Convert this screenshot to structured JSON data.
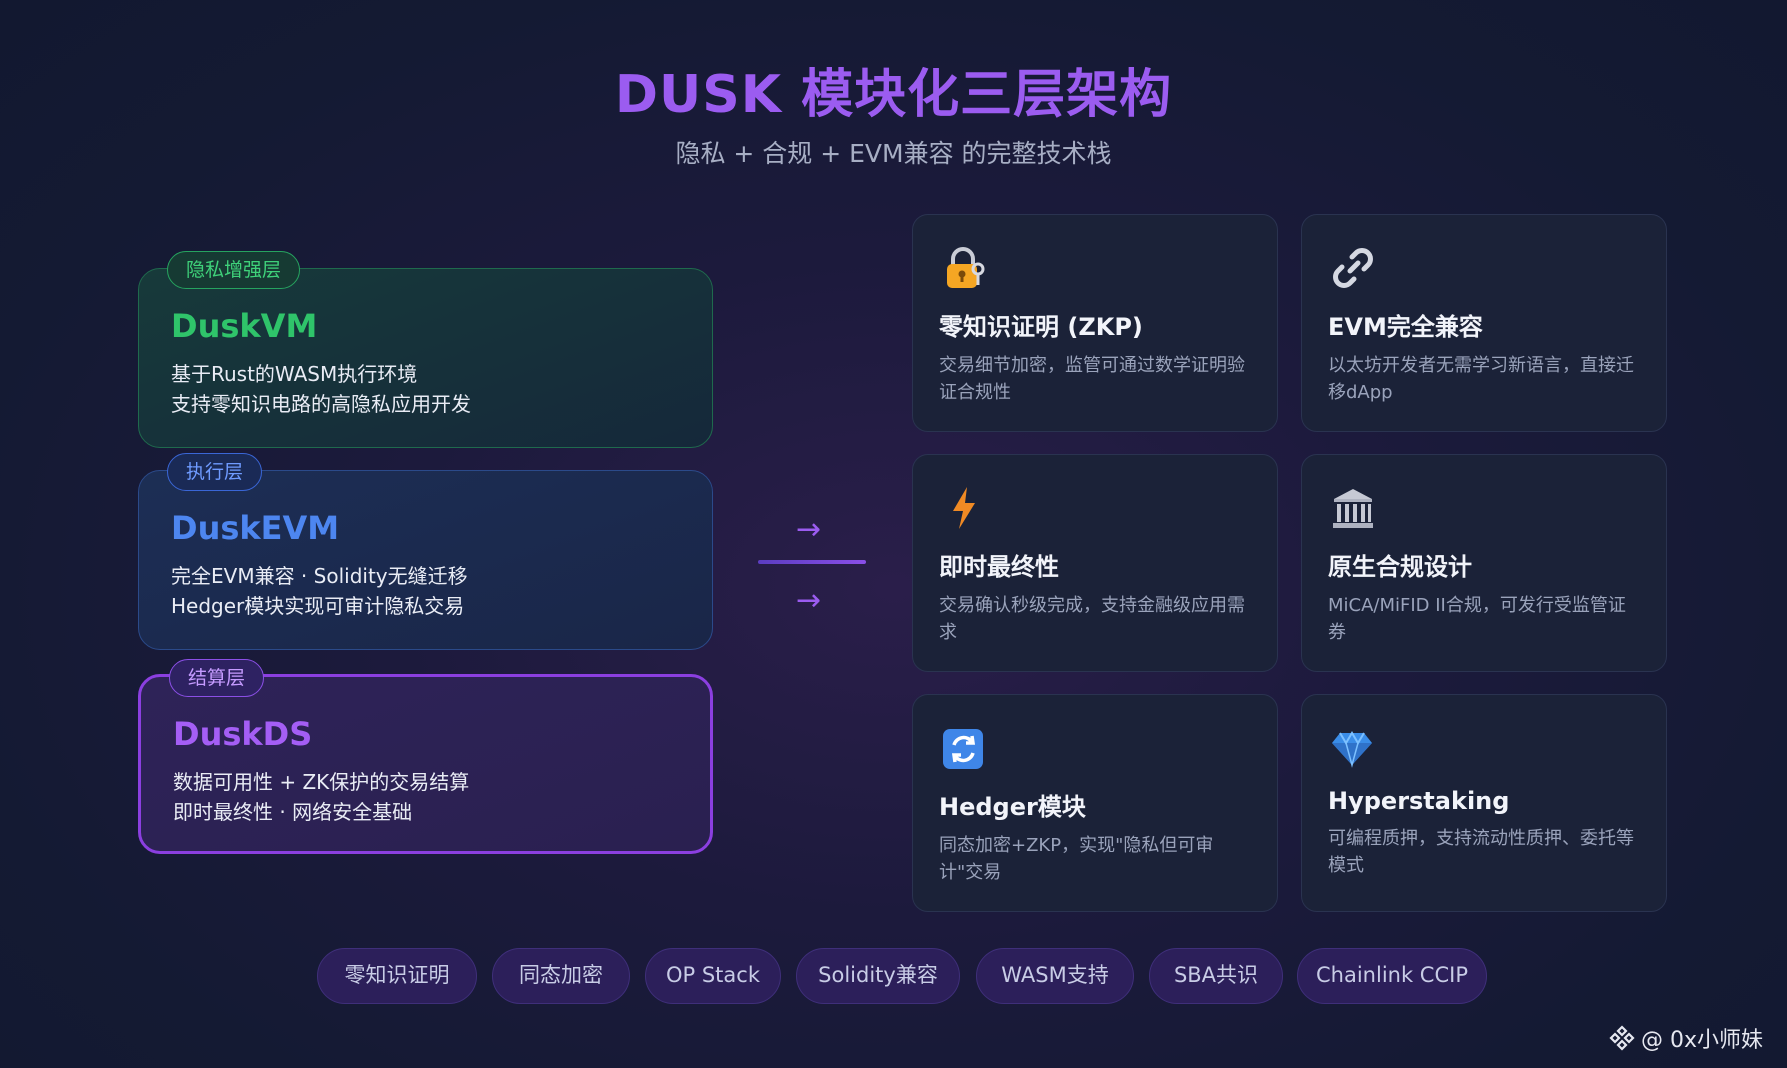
{
  "header": {
    "title": "DUSK 模块化三层架构",
    "subtitle": "隐私 + 合规 + EVM兼容 的完整技术栈"
  },
  "layers": [
    {
      "badge": "隐私增强层",
      "name": "DuskVM",
      "desc_line1": "基于Rust的WASM执行环境",
      "desc_line2": "支持零知识电路的高隐私应用开发"
    },
    {
      "badge": "执行层",
      "name": "DuskEVM",
      "desc_line1": "完全EVM兼容 · Solidity无缝迁移",
      "desc_line2": "Hedger模块实现可审计隐私交易"
    },
    {
      "badge": "结算层",
      "name": "DuskDS",
      "desc_line1": "数据可用性 + ZK保护的交易结算",
      "desc_line2": "即时最终性 · 网络安全基础"
    }
  ],
  "connector": {
    "arrow_glyph": "→"
  },
  "features": [
    {
      "icon": "lock-key-icon",
      "title": "零知识证明 (ZKP)",
      "desc": "交易细节加密，监管可通过数学证明验证合规性"
    },
    {
      "icon": "link-icon",
      "title": "EVM完全兼容",
      "desc": "以太坊开发者无需学习新语言，直接迁移dApp"
    },
    {
      "icon": "lightning-icon",
      "title": "即时最终性",
      "desc": "交易确认秒级完成，支持金融级应用需求"
    },
    {
      "icon": "bank-icon",
      "title": "原生合规设计",
      "desc": "MiCA/MiFID II合规，可发行受监管证券"
    },
    {
      "icon": "refresh-icon",
      "title": "Hedger模块",
      "desc": "同态加密+ZKP，实现\"隐私但可审计\"交易"
    },
    {
      "icon": "diamond-icon",
      "title": "Hyperstaking",
      "desc": "可编程质押，支持流动性质押、委托等模式"
    }
  ],
  "tags": [
    "零知识证明",
    "同态加密",
    "OP Stack",
    "Solidity兼容",
    "WASM支持",
    "SBA共识",
    "Chainlink CCIP"
  ],
  "watermark": {
    "text": "@ 0x小师妹"
  },
  "colors": {
    "title": "#9b5cf0",
    "privacy_layer": "#2fc46a",
    "execution_layer": "#4d86f0",
    "settlement_layer": "#a45ef5"
  }
}
